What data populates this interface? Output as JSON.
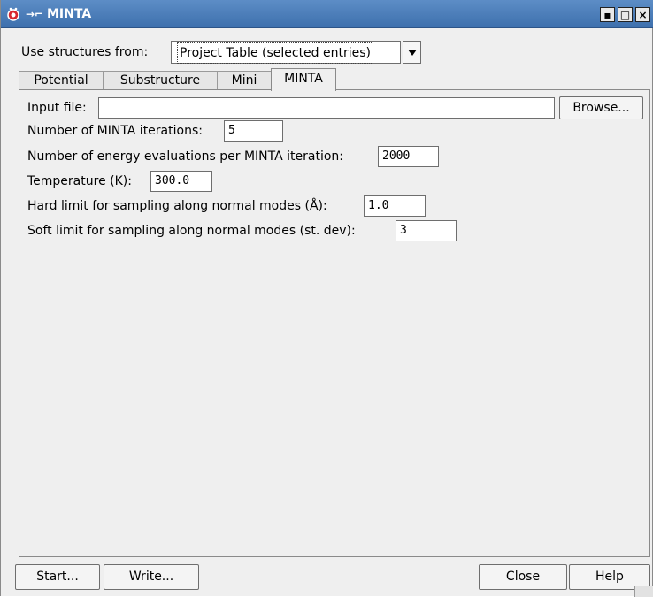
{
  "window": {
    "title": "MINTA",
    "pin_glyph": "→⌐",
    "minimize_glyph": "▪",
    "maximize_glyph": "□",
    "close_glyph": "×",
    "titlebar_color": "#4a7cbb"
  },
  "source": {
    "label": "Use structures from:",
    "selected": "Project Table (selected entries)"
  },
  "tabs": [
    {
      "label": "Potential",
      "active": false
    },
    {
      "label": "Substructure",
      "active": false
    },
    {
      "label": "Mini",
      "active": false
    },
    {
      "label": "MINTA",
      "active": true
    }
  ],
  "form": {
    "input_file": {
      "label": "Input file:",
      "value": "",
      "browse": "Browse..."
    },
    "iterations": {
      "label": "Number of MINTA iterations:",
      "value": "5"
    },
    "evaluations": {
      "label": "Number of energy evaluations per MINTA iteration:",
      "value": "2000"
    },
    "temperature": {
      "label": "Temperature (K):",
      "value": "300.0"
    },
    "hard_limit": {
      "label": "Hard limit for sampling along normal modes (Å):",
      "value": "1.0"
    },
    "soft_limit": {
      "label": "Soft limit for sampling along normal modes (st. dev):",
      "value": "3"
    }
  },
  "buttons": {
    "start": "Start...",
    "write": "Write...",
    "close": "Close",
    "help": "Help"
  }
}
